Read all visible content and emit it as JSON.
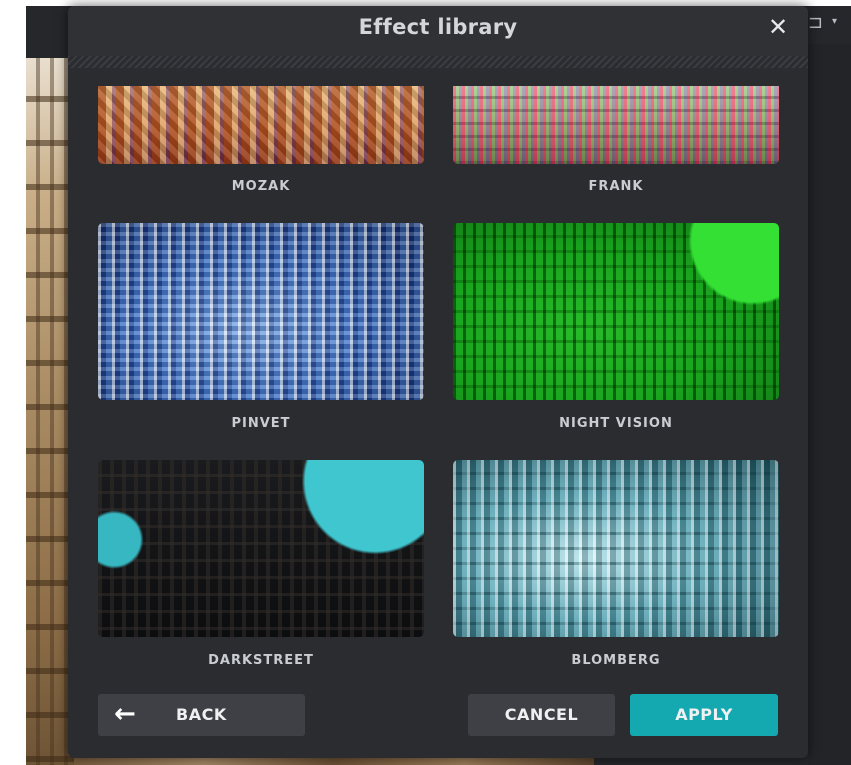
{
  "dialog": {
    "title": "Effect library",
    "close_icon": "close-icon",
    "close_glyph": "✕"
  },
  "effects": [
    {
      "label": "MOZAK"
    },
    {
      "label": "FRANK"
    },
    {
      "label": "PINVET"
    },
    {
      "label": "NIGHT VISION"
    },
    {
      "label": "DARKSTREET"
    },
    {
      "label": "BLOMBERG"
    }
  ],
  "footer": {
    "back_label": "BACK",
    "back_icon": "arrow-left-icon",
    "back_glyph": "←",
    "cancel_label": "CANCEL",
    "apply_label": "APPLY"
  },
  "topbar": {
    "icon": "window-icon",
    "glyph": "⊐",
    "caret_glyph": "▾"
  },
  "colors": {
    "accent": "#14a8b0",
    "dialog_bg": "#2a2c30",
    "button_bg": "#3e4045"
  }
}
